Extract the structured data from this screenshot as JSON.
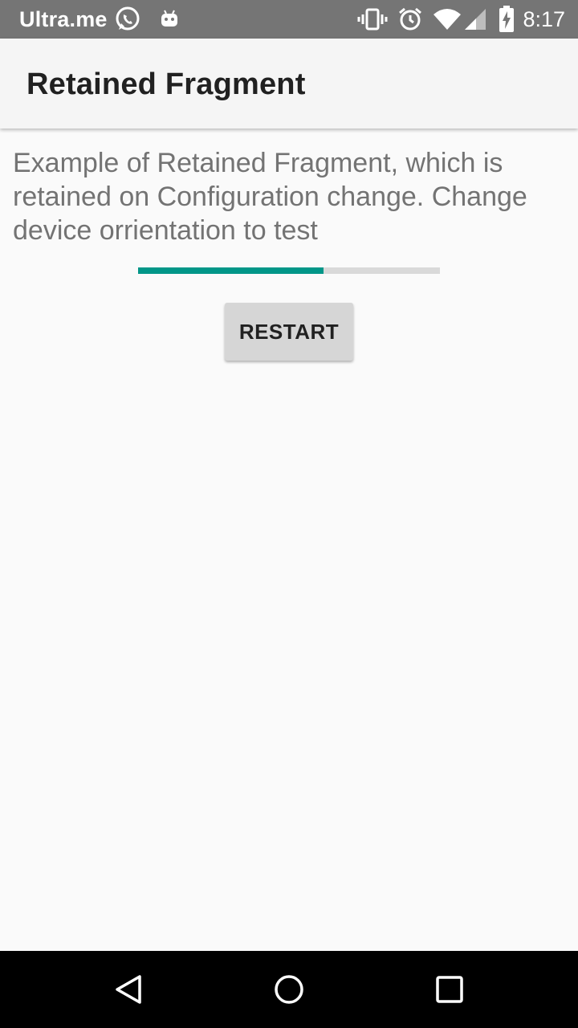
{
  "status_bar": {
    "carrier": "Ultra.me",
    "time": "8:17",
    "left_icons": [
      "whatsapp-icon",
      "android-debug-icon"
    ],
    "right_icons": [
      "vibrate-icon",
      "alarm-icon",
      "wifi-icon",
      "cell-signal-icon",
      "battery-charging-icon"
    ]
  },
  "app_bar": {
    "title": "Retained Fragment"
  },
  "main": {
    "description": "Example of Retained Fragment, which is retained on Configuration change. Change device orrientation to test",
    "progress": {
      "value_percent": 61.5,
      "fill_color": "#009688",
      "track_color": "#d9d9d9"
    },
    "restart_label": "RESTART"
  },
  "nav_bar": {
    "buttons": [
      "back-icon",
      "home-icon",
      "recents-icon"
    ]
  }
}
